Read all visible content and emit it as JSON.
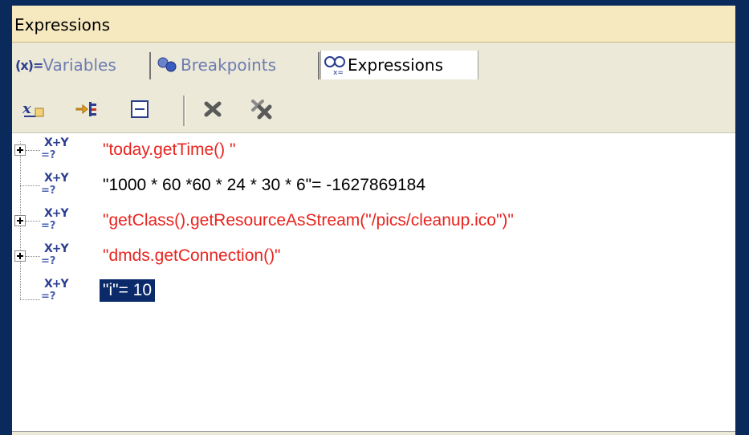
{
  "panel": {
    "title": "Expressions"
  },
  "tabs": [
    {
      "icon_text": "(x)=",
      "label": "Variables",
      "active": false
    },
    {
      "label": "Breakpoints",
      "active": false
    },
    {
      "label": "Expressions",
      "active": true
    }
  ],
  "toolbar": {
    "buttons": [
      "add-watch-expression-icon",
      "show-type-names-icon",
      "collapse-all-icon",
      "remove-icon",
      "remove-all-icon"
    ]
  },
  "tree": {
    "icon": {
      "top": "X+Y",
      "bottom": "=?"
    },
    "rows": [
      {
        "text": "\"today.getTime() \"",
        "expandable": true,
        "error": true,
        "selected": false
      },
      {
        "text": "\"1000 * 60 *60 * 24 * 30 * 6\"= -1627869184",
        "expandable": false,
        "error": false,
        "selected": false
      },
      {
        "text": "\"getClass().getResourceAsStream(\"/pics/cleanup.ico\")\"",
        "expandable": true,
        "error": true,
        "selected": false
      },
      {
        "text": "\"dmds.getConnection()\"",
        "expandable": true,
        "error": true,
        "selected": false
      },
      {
        "text": "\"i\"= 10",
        "expandable": false,
        "error": false,
        "selected": true
      }
    ]
  },
  "colors": {
    "error_text": "#e8241f",
    "selection_bg": "#0b2a6a",
    "title_bg": "#f6e9bf",
    "toolbar_bg": "#ece9d8"
  }
}
